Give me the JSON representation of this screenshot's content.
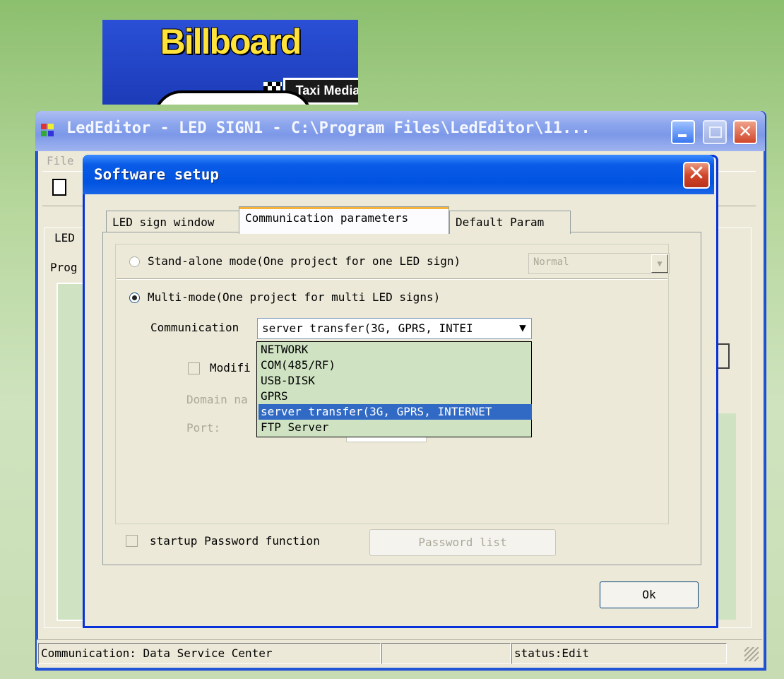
{
  "logo": {
    "title": "Billboard",
    "subtitle": "Taxi Media"
  },
  "main_window": {
    "title": "LedEditor - LED SIGN1 - C:\\Program Files\\LedEditor\\11...",
    "menu_file": "File",
    "panel_label_1": "LED",
    "panel_label_2": "Prog"
  },
  "dialog": {
    "title": "Software setup",
    "close_glyph": "✕",
    "tabs": [
      {
        "label": "LED sign window"
      },
      {
        "label": "Communication parameters"
      },
      {
        "label": "Default Param"
      }
    ],
    "standalone": {
      "label": "Stand-alone mode(One project for one LED sign)",
      "selected": false,
      "combo_value": "Normal"
    },
    "multimode": {
      "label": "Multi-mode(One project for multi LED signs)",
      "selected": true
    },
    "communication": {
      "label": "Communication",
      "selected_value": "server transfer(3G, GPRS, INTEI",
      "options": [
        "NETWORK",
        "COM(485/RF)",
        "USB-DISK",
        "GPRS",
        "server transfer(3G, GPRS, INTERNET",
        "FTP Server"
      ],
      "highlighted_index": 4
    },
    "modify_label": "Modifi",
    "domain_label": "Domain na",
    "port_label": "Port:",
    "password_checkbox": "startup Password function",
    "password_button": "Password list",
    "ok_button": "Ok"
  },
  "status_bar": {
    "communication": "Communication: Data Service Center",
    "middle": "",
    "status": "status:Edit"
  }
}
